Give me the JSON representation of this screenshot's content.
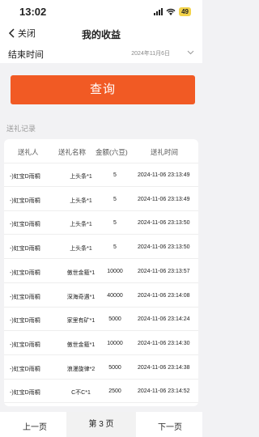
{
  "status_bar": {
    "time": "13:02",
    "battery": "49"
  },
  "navbar": {
    "back_label": "关闭",
    "title": "我的收益"
  },
  "filter": {
    "end_time_label": "结束时间",
    "end_time_value": "2024年11月6日"
  },
  "query_button": {
    "label": "查询"
  },
  "section": {
    "title": "送礼记录"
  },
  "table": {
    "headers": [
      "送礼人",
      "送礼名称",
      "金额(六豆)",
      "送礼时间"
    ],
    "rows": [
      [
        "-)虹宝D雨桐",
        "上头条*1",
        "5",
        "2024-11-06 23:13:49"
      ],
      [
        "-)虹宝D雨桐",
        "上头条*1",
        "5",
        "2024-11-06 23:13:49"
      ],
      [
        "-)虹宝D雨桐",
        "上头条*1",
        "5",
        "2024-11-06 23:13:50"
      ],
      [
        "-)虹宝D雨桐",
        "上头条*1",
        "5",
        "2024-11-06 23:13:50"
      ],
      [
        "-)虹宝D雨桐",
        "傲世金箍*1",
        "10000",
        "2024-11-06 23:13:57"
      ],
      [
        "-)虹宝D雨桐",
        "深海奇遇*1",
        "40000",
        "2024-11-06 23:14:08"
      ],
      [
        "-)虹宝D雨桐",
        "家里有矿*1",
        "5000",
        "2024-11-06 23:14:24"
      ],
      [
        "-)虹宝D雨桐",
        "傲世金箍*1",
        "10000",
        "2024-11-06 23:14:30"
      ],
      [
        "-)虹宝D雨桐",
        "浪漫旋律*2",
        "5000",
        "2024-11-06 23:14:38"
      ],
      [
        "-)虹宝D雨桐",
        "C不C*1",
        "2500",
        "2024-11-06 23:14:52"
      ]
    ]
  },
  "pager": {
    "prev_label": "上一页",
    "current_label": "第 3 页",
    "next_label": "下一页"
  },
  "colors": {
    "accent": "#f15a24",
    "background": "#f2f2f4"
  }
}
